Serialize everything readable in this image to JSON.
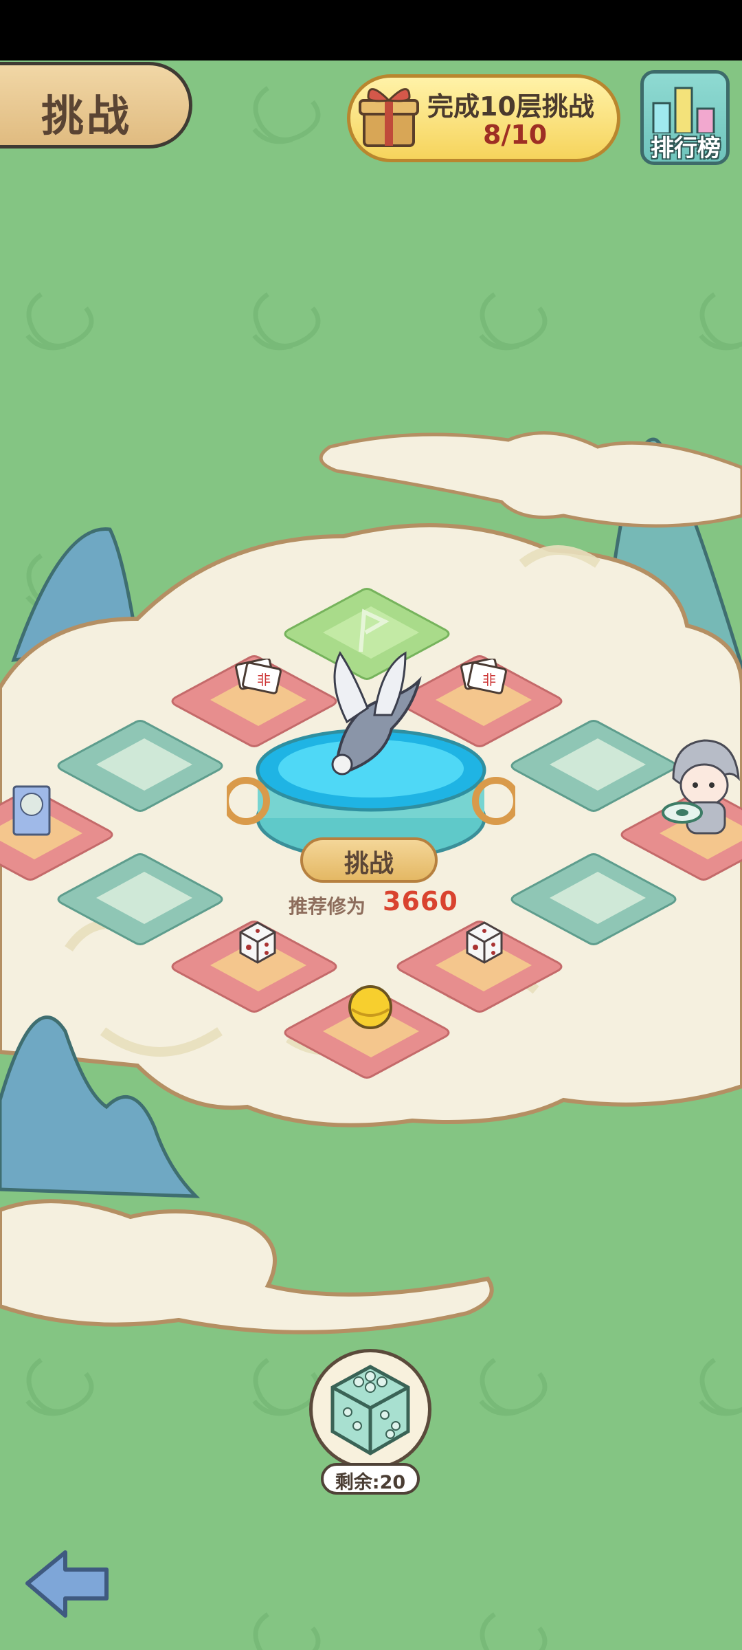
{
  "header": {
    "title": "挑战",
    "task_text": "完成10层挑战",
    "task_progress": "8/10",
    "rank_label": "排行榜"
  },
  "board": {
    "center_platform": {
      "button_label": "挑战",
      "recommend_label": "推荐修为",
      "recommend_value": "3660"
    },
    "tiles": [
      {
        "id": "top-flag",
        "color": "green",
        "content": "flag-icon"
      },
      {
        "id": "upper-left",
        "color": "pink",
        "content": "talisman-icon"
      },
      {
        "id": "upper-right",
        "color": "pink",
        "content": "talisman-icon"
      },
      {
        "id": "mid-left-1",
        "color": "teal",
        "content": ""
      },
      {
        "id": "mid-right-1",
        "color": "teal",
        "content": ""
      },
      {
        "id": "far-left",
        "color": "pink",
        "content": "character-card-icon"
      },
      {
        "id": "far-right",
        "color": "pink",
        "content": "hero-character"
      },
      {
        "id": "mid-left-2",
        "color": "teal",
        "content": ""
      },
      {
        "id": "mid-right-2",
        "color": "teal",
        "content": ""
      },
      {
        "id": "low-left",
        "color": "pink",
        "content": "dice-icon"
      },
      {
        "id": "low-right",
        "color": "pink",
        "content": "dice-icon"
      },
      {
        "id": "bottom",
        "color": "pink",
        "content": "gold-orb-icon"
      }
    ]
  },
  "dice": {
    "remaining_text": "剩余:20"
  },
  "colors": {
    "background": "#84c583",
    "cloud": "#f5f0df",
    "tile_pink": "#e78e8e",
    "tile_teal": "#8fc6b5",
    "tile_green": "#a9db8a",
    "accent_red": "#d9432f"
  }
}
